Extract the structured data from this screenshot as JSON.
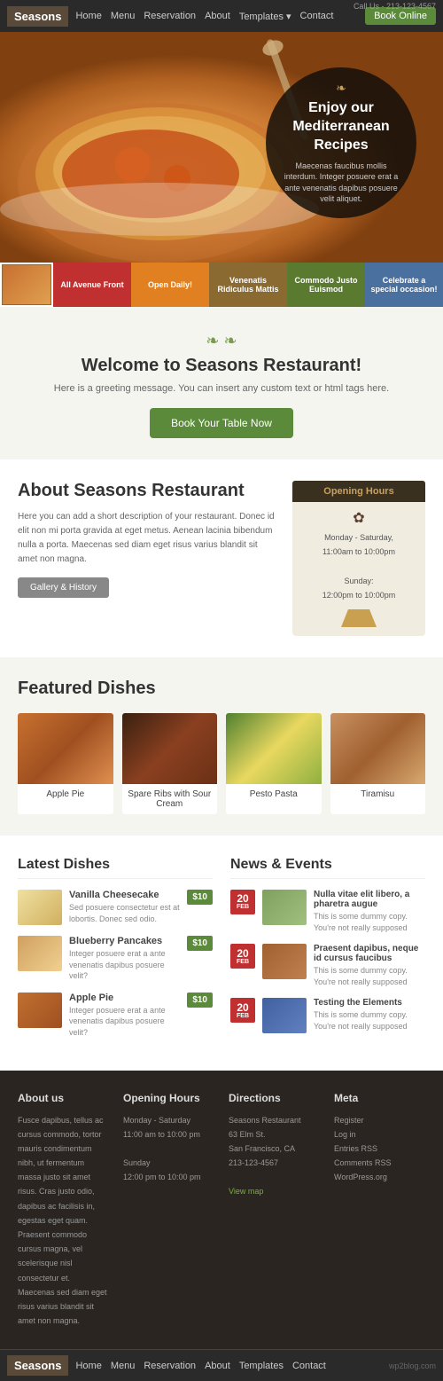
{
  "site": {
    "brand": "Seasons",
    "phone": "Call Us - 213-123-4567",
    "book_online": "Book Online"
  },
  "nav": {
    "links": [
      "Home",
      "Menu",
      "Reservation",
      "About",
      "Templates",
      "Contact"
    ]
  },
  "hero": {
    "deco": "❧",
    "title": "Enjoy our Mediterranean Recipes",
    "subtitle": "Maecenas faucibus mollis interdum. Integer posuere erat a ante venenatis dapibus posuere velit aliquet."
  },
  "tabs": [
    {
      "label": "Enjoy our Mediterranean Recipes",
      "color": "#8a6a40",
      "type": "thumb"
    },
    {
      "label": "All Avenue Front",
      "color": "#c03030"
    },
    {
      "label": "Open Daily!",
      "color": "#e08020"
    },
    {
      "label": "Venenatis Ridiculus Mattis",
      "color": "#8a6a30"
    },
    {
      "label": "Commodo Justo Euismod",
      "color": "#5a7a30"
    },
    {
      "label": "Celebrate a special occasion!",
      "color": "#4a70a0"
    }
  ],
  "welcome": {
    "deco_left": "❧",
    "deco_right": "❧",
    "title": "Welcome to Seasons Restaurant!",
    "subtitle": "Here is a greeting message. You can insert any custom text or html tags here.",
    "cta": "Book Your Table Now"
  },
  "about": {
    "title": "About Seasons Restaurant",
    "body": "Here you can add a short description of your restaurant. Donec id elit non mi porta gravida at eget metus. Aenean lacinia bibendum nulla a porta. Maecenas sed diam eget risus varius blandit sit amet non magna.",
    "gallery_btn": "Gallery & History",
    "opening_hours": {
      "title": "Opening Hours",
      "deco": "✿",
      "lines": [
        "Monday - Saturday,",
        "11:00am to 10:00pm",
        "",
        "Sunday:",
        "12:00pm to 10:00pm"
      ]
    }
  },
  "featured": {
    "title": "Featured Dishes",
    "dishes": [
      {
        "name": "Apple Pie",
        "img_class": "apple-pie"
      },
      {
        "name": "Spare Ribs with Sour Cream",
        "img_class": "spare-ribs"
      },
      {
        "name": "Pesto Pasta",
        "img_class": "pesto-pasta"
      },
      {
        "name": "Tiramisu",
        "img_class": "tiramisu"
      }
    ]
  },
  "latest_dishes": {
    "title": "Latest Dishes",
    "items": [
      {
        "name": "Vanilla Cheesecake",
        "desc": "Sed posuere consectetur est at lobortis. Donec sed odio.",
        "price": "$10",
        "img_class": "vc"
      },
      {
        "name": "Blueberry Pancakes",
        "desc": "Integer posuere erat a ante venenatis dapibus posuere velit?",
        "price": "$10",
        "img_class": "bp"
      },
      {
        "name": "Apple Pie",
        "desc": "Integer posuere erat a ante venenatis dapibus posuere velit?",
        "price": "$10",
        "img_class": "ap"
      }
    ]
  },
  "news_events": {
    "title": "News & Events",
    "items": [
      {
        "title": "Nulla vitae elit libero, a pharetra augue",
        "desc": "This is some dummy copy. You're not really supposed",
        "day": "20",
        "month": "FEB",
        "img_class": "n1"
      },
      {
        "title": "Praesent dapibus, neque id cursus faucibus",
        "desc": "This is some dummy copy. You're not really supposed",
        "day": "20",
        "month": "FEB",
        "img_class": "n2"
      },
      {
        "title": "Testing the Elements",
        "desc": "This is some dummy copy. You're not really supposed",
        "day": "20",
        "month": "FEB",
        "img_class": "n3"
      }
    ]
  },
  "footer": {
    "cols": [
      {
        "title": "About us",
        "type": "text",
        "content": "Fusce dapibus, tellus ac cursus commodo, tortor mauris condimentum nibh, ut fermentum massa justo sit amet risus. Cras justo odio, dapibus ac facilisis in, egestas eget quam. Praesent commodo cursus magna, vel scelerisque nisl consectetur et. Maecenas sed diam eget risus varius blandit sit amet non magna."
      },
      {
        "title": "Opening Hours",
        "type": "text",
        "lines": [
          "Monday - Saturday",
          "11:00 am to 10:00 pm",
          "",
          "Sunday",
          "12:00 pm to 10:00 pm"
        ]
      },
      {
        "title": "Directions",
        "type": "text",
        "lines": [
          "Seasons Restaurant",
          "63 Elm St.",
          "San Francisco, CA",
          "213-123-4567",
          "",
          "View map"
        ]
      },
      {
        "title": "Meta",
        "type": "links",
        "links": [
          "Register",
          "Log in",
          "Entries RSS",
          "Comments RSS",
          "WordPress.org"
        ]
      }
    ]
  },
  "bottom_nav": {
    "brand": "Seasons",
    "links": [
      "Home",
      "Menu",
      "Reservation",
      "About",
      "Templates",
      "Contact"
    ],
    "watermark": "wp2blog.com"
  }
}
